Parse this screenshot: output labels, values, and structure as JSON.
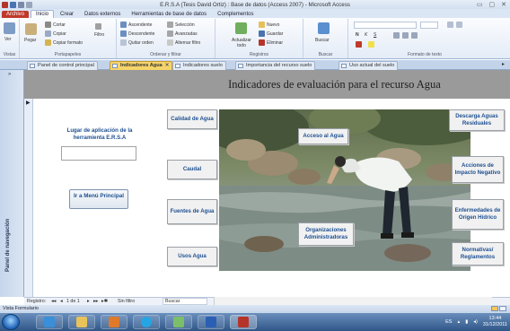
{
  "window": {
    "title": "E.R.S.A (Tesis David Ortiz) : Base de datos (Access 2007) - Microsoft Access",
    "controls": [
      "▭",
      "▢",
      "✕"
    ]
  },
  "ribbon_tabs": [
    "Archivo",
    "Inicio",
    "Crear",
    "Datos externos",
    "Herramientas de base de datos",
    "Complementos"
  ],
  "ribbon": {
    "views": {
      "label": "Ver",
      "group": "Vistas"
    },
    "clipboard": {
      "paste": "Pegar",
      "cut": "Cortar",
      "copy": "Copiar",
      "format": "Copiar formato",
      "group": "Portapapeles"
    },
    "sort": {
      "filter": "Filtro",
      "asc": "Ascendente",
      "desc": "Descendente",
      "remove": "Quitar orden",
      "selection": "Selección",
      "advanced": "Avanzadas",
      "toggle": "Alternar filtro",
      "group": "Ordenar y filtrar"
    },
    "records": {
      "refresh": "Actualizar todo",
      "new": "Nuevo",
      "save": "Guardar",
      "delete": "Eliminar",
      "group": "Registros"
    },
    "find": {
      "search": "Buscar",
      "group": "Buscar"
    },
    "text": {
      "bold": "N",
      "italic": "K",
      "underline": "S",
      "group": "Formato de texto"
    }
  },
  "doc_tabs": [
    "Panel de control principal",
    "Indicadores Agua",
    "Indicadores suelo",
    "Importancia del recurso suelo",
    "Uso actual del suelo"
  ],
  "nav_pane": {
    "label": "Panel de navegación",
    "toggle": "»"
  },
  "form": {
    "title": "Indicadores de evaluación para el recurso Agua",
    "left_label": "Lugar de aplicación de la herramienta E.R.S.A",
    "input_value": "",
    "menu_button": "Ir a Menú Principal",
    "blocks": {
      "calidad": "Calidad de Agua",
      "acceso": "Acceso al Agua",
      "descarga": "Descarga Aguas Residuales",
      "caudal": "Caudal",
      "acciones": "Acciones de Impacto Negativo",
      "fuentes": "Fuentes de Agua",
      "enfermedades": "Enfermedades de Origen Hídrico",
      "organizaciones": "Organizaciones Administradoras",
      "usos": "Usos Agua",
      "normativas": "Normativas/ Reglamentos"
    }
  },
  "record_nav": {
    "label": "Registro:",
    "position": "1 de 1",
    "filter": "Sin filtro",
    "search_placeholder": "Buscar"
  },
  "status": {
    "left": "Vista Formulario"
  },
  "taskbar": {
    "apps": [
      "explorer",
      "ie",
      "folder",
      "media",
      "skype",
      "paint",
      "word",
      "access"
    ]
  },
  "tray": {
    "lang": "ES",
    "time": "13:44",
    "date": "31/12/2011"
  },
  "colors": {
    "accent": "#1d4f91",
    "file_tab": "#c0392b",
    "active_doc_tab": "#f6d46a",
    "header": "#9a9a9a"
  }
}
